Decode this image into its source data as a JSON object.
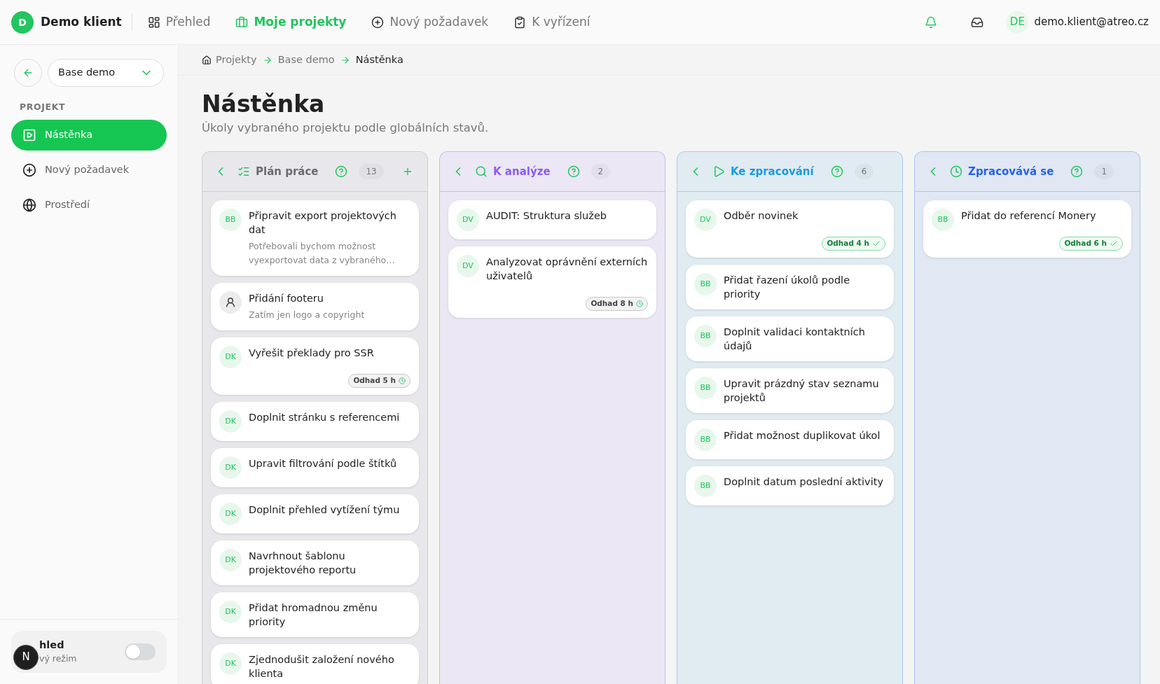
{
  "brand": {
    "initial": "D",
    "name": "Demo klient"
  },
  "nav": [
    {
      "label": "Přehled",
      "selected": false
    },
    {
      "label": "Moje projekty",
      "selected": true
    },
    {
      "label": "Nový požadavek",
      "selected": false
    },
    {
      "label": "K vyřízení",
      "selected": false
    }
  ],
  "user": {
    "initials": "DE",
    "email": "demo.klient@atreo.cz"
  },
  "sidebar": {
    "project": "Base demo",
    "section": "PROJEKT",
    "items": [
      {
        "label": "Nástěnka",
        "selected": true
      },
      {
        "label": "Nový požadavek",
        "selected": false
      },
      {
        "label": "Prostředí",
        "selected": false
      }
    ],
    "appearance": {
      "title": "hled",
      "subtitle": "vý režim",
      "on": false
    },
    "dev_badge": "N"
  },
  "breadcrumbs": [
    "Projekty",
    "Base demo",
    "Nástěnka"
  ],
  "page": {
    "title": "Nástěnka",
    "subtitle": "Úkoly vybraného projektu podle globálních stavů."
  },
  "columns": [
    {
      "title": "Plán práce",
      "count": "13",
      "can_add": true,
      "cards": [
        {
          "avatar": "BB",
          "kind": "initials",
          "title": "Připravit export projektových dat",
          "description": "Potřebovali bychom možnost vyexportovat data z vybraného…"
        },
        {
          "kind": "icon",
          "title": "Přidání footeru",
          "description": "Zatím jen logo a copyright"
        },
        {
          "avatar": "DK",
          "kind": "initials",
          "title": "Vyřešit překlady pro SSR",
          "estimate": {
            "label": "Odhad 5 h",
            "kind": "pending"
          }
        },
        {
          "avatar": "DK",
          "kind": "initials",
          "title": "Doplnit stránku s referencemi"
        },
        {
          "avatar": "DK",
          "kind": "initials",
          "title": "Upravit filtrování podle štítků"
        },
        {
          "avatar": "DK",
          "kind": "initials",
          "title": "Doplnit přehled vytížení týmu"
        },
        {
          "avatar": "DK",
          "kind": "initials",
          "title": "Navrhnout šablonu projektového reportu"
        },
        {
          "avatar": "DK",
          "kind": "initials",
          "title": "Přidat hromadnou změnu priority"
        },
        {
          "avatar": "DK",
          "kind": "initials",
          "title": "Zjednodušit založení nového klienta"
        }
      ]
    },
    {
      "title": "K analýze",
      "count": "2",
      "can_add": false,
      "cards": [
        {
          "avatar": "DV",
          "kind": "initials",
          "title": "AUDIT: Struktura služeb"
        },
        {
          "avatar": "DV",
          "kind": "initials",
          "title": "Analyzovat oprávnění externích uživatelů",
          "estimate": {
            "label": "Odhad 8 h",
            "kind": "pending"
          }
        }
      ]
    },
    {
      "title": "Ke zpracování",
      "count": "6",
      "can_add": false,
      "cards": [
        {
          "avatar": "DV",
          "kind": "initials",
          "title": "Odběr novinek",
          "estimate": {
            "label": "Odhad 4 h",
            "kind": "approved"
          }
        },
        {
          "avatar": "BB",
          "kind": "initials",
          "title": "Přidat řazení úkolů podle priority"
        },
        {
          "avatar": "BB",
          "kind": "initials",
          "title": "Doplnit validaci kontaktních údajů"
        },
        {
          "avatar": "BB",
          "kind": "initials",
          "title": "Upravit prázdný stav seznamu projektů"
        },
        {
          "avatar": "BB",
          "kind": "initials",
          "title": "Přidat možnost duplikovat úkol"
        },
        {
          "avatar": "BB",
          "kind": "initials",
          "title": "Doplnit datum poslední aktivity"
        }
      ]
    },
    {
      "title": "Zpracovává se",
      "count": "1",
      "can_add": false,
      "cards": [
        {
          "avatar": "BB",
          "kind": "initials",
          "title": "Přidat do referencí Monery",
          "estimate": {
            "label": "Odhad 6 h",
            "kind": "approved"
          }
        }
      ]
    }
  ]
}
